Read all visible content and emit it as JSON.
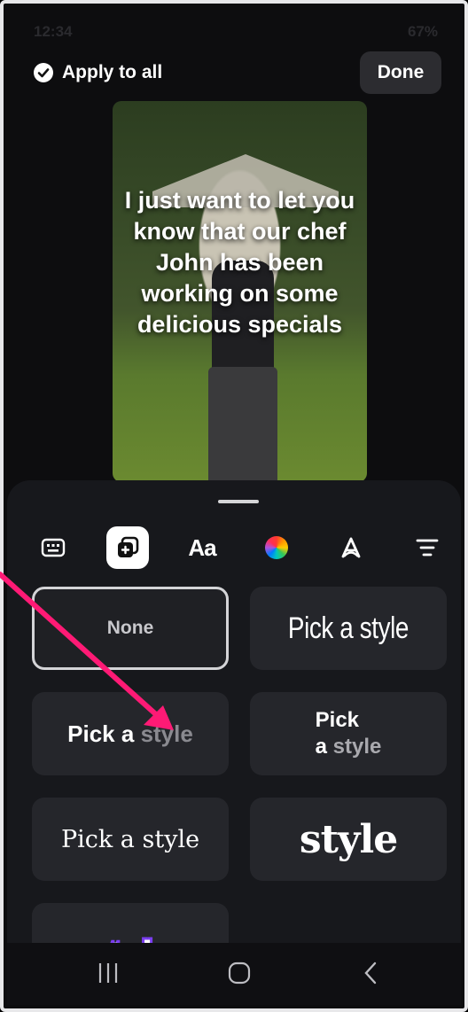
{
  "status": {
    "time": "12:34",
    "battery": "67%"
  },
  "header": {
    "apply_to_all": "Apply to all",
    "done": "Done"
  },
  "preview": {
    "caption": "I just want to let you know that our chef John has been working on some delicious specials"
  },
  "toolbar": {
    "items": [
      {
        "name": "keyboard-icon"
      },
      {
        "name": "text-style-icon",
        "active": true
      },
      {
        "name": "font-icon",
        "label": "Aa"
      },
      {
        "name": "color-icon"
      },
      {
        "name": "effects-icon"
      },
      {
        "name": "align-icon"
      }
    ]
  },
  "styles": {
    "none": "None",
    "condensed": "Pick a style",
    "bold_main": "Pick a ",
    "bold_dim": "style",
    "stack_line1": "Pick",
    "stack_line2_a": "a ",
    "stack_line2_b": "style",
    "serif": "Pick a style",
    "heavy": "style",
    "purple": "style"
  },
  "colors": {
    "accent_arrow": "#ff1a75",
    "sheet_bg": "#17181c",
    "tile_bg": "#25262b",
    "purple_outline": "#7a3df0"
  }
}
